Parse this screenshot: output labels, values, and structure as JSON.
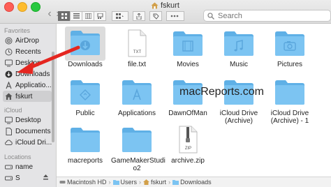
{
  "window": {
    "title": "fskurt",
    "search_placeholder": "Search"
  },
  "toolbar": {
    "back_glyph": "‹",
    "forward_glyph": "›"
  },
  "sidebar": {
    "favorites_heading": "Favorites",
    "favorites": [
      {
        "label": "AirDrop",
        "icon": "airdrop-icon"
      },
      {
        "label": "Recents",
        "icon": "clock-icon"
      },
      {
        "label": "Desktop",
        "icon": "desktop-icon"
      },
      {
        "label": "Downloads",
        "icon": "downloads-icon"
      },
      {
        "label": "Applicatio...",
        "icon": "applications-icon"
      },
      {
        "label": "fskurt",
        "icon": "home-icon",
        "selected": true
      }
    ],
    "icloud_heading": "iCloud",
    "icloud": [
      {
        "label": "Desktop",
        "icon": "desktop-icon"
      },
      {
        "label": "Documents",
        "icon": "document-icon"
      },
      {
        "label": "iCloud Dri...",
        "icon": "cloud-icon"
      }
    ],
    "locations_heading": "Locations",
    "locations": [
      {
        "label": "name",
        "icon": "disk-icon"
      },
      {
        "label": "S",
        "icon": "disk-icon"
      }
    ]
  },
  "files": [
    {
      "label": "Downloads",
      "kind": "downloads-folder",
      "selected": true
    },
    {
      "label": "file.txt",
      "kind": "txt-file",
      "badge": "TXT"
    },
    {
      "label": "Movies",
      "kind": "movies-folder"
    },
    {
      "label": "Music",
      "kind": "music-folder"
    },
    {
      "label": "Pictures",
      "kind": "pictures-folder"
    },
    {
      "label": "Public",
      "kind": "public-folder"
    },
    {
      "label": "Applications",
      "kind": "applications-folder"
    },
    {
      "label": "DawnOfMan",
      "kind": "folder"
    },
    {
      "label": "iCloud Drive\n(Archive)",
      "kind": "folder"
    },
    {
      "label": "iCloud Drive\n(Archive) - 1",
      "kind": "folder"
    },
    {
      "label": "macreports",
      "kind": "folder"
    },
    {
      "label": "GameMakerStudi\no2",
      "kind": "folder"
    },
    {
      "label": "archive.zip",
      "kind": "zip-file",
      "badge": "ZIP"
    }
  ],
  "watermark": "macReports.com",
  "pathbar": [
    {
      "label": "Macintosh HD",
      "icon": "disk-icon"
    },
    {
      "label": "Users",
      "icon": "folder-icon"
    },
    {
      "label": "fskurt",
      "icon": "home-icon"
    },
    {
      "label": "Downloads",
      "icon": "folder-icon"
    }
  ],
  "colors": {
    "folder": "#7cc4f2",
    "folder_dark": "#5fb0e6",
    "arrow": "#e52620",
    "selection": "#1a6de0"
  }
}
